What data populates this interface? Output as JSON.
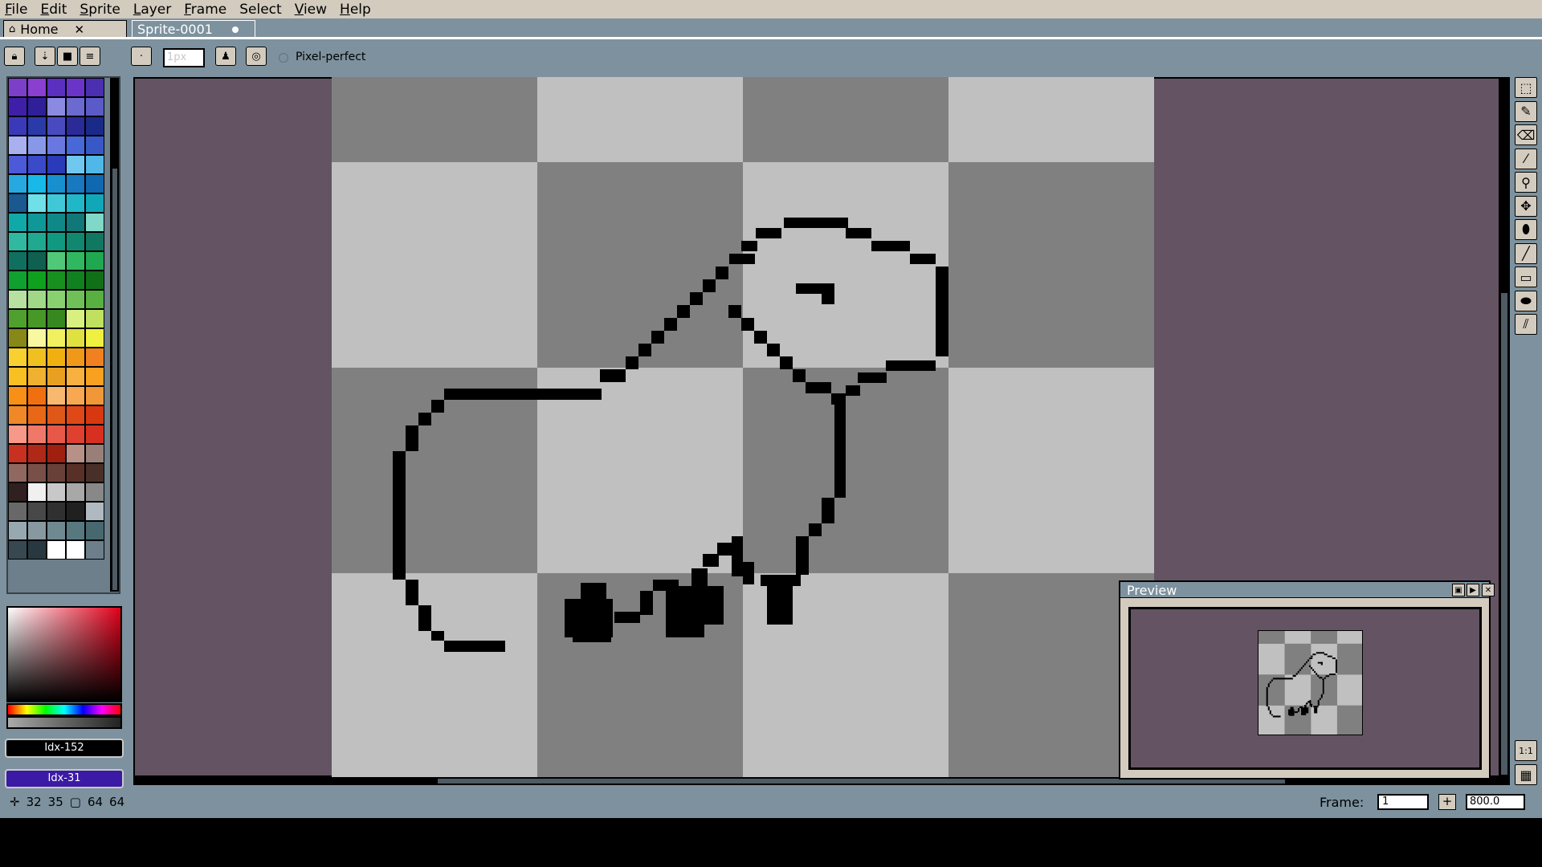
{
  "menu": {
    "items": [
      {
        "label": "File",
        "ul": "F",
        "rest": "ile"
      },
      {
        "label": "Edit",
        "ul": "E",
        "rest": "dit"
      },
      {
        "label": "Sprite",
        "ul": "S",
        "rest": "prite"
      },
      {
        "label": "Layer",
        "ul": "L",
        "rest": "ayer"
      },
      {
        "label": "Frame",
        "ul": "F",
        "rest": "rame"
      },
      {
        "label": "Select",
        "ul": "",
        "rest": "Select"
      },
      {
        "label": "View",
        "ul": "V",
        "rest": "iew"
      },
      {
        "label": "Help",
        "ul": "H",
        "rest": "elp"
      }
    ]
  },
  "tabs": {
    "home_label": "Home",
    "home_close": "✕",
    "sprite_label": "Sprite-0001"
  },
  "toolbar": {
    "brush_size_placeholder": "1px",
    "pixel_perfect_label": "Pixel-perfect"
  },
  "palette": {
    "colors": [
      "#7b3fc8",
      "#8a3fd0",
      "#5b2fc0",
      "#6a34c8",
      "#4a2fb0",
      "#3f1fa8",
      "#2f1f98",
      "#8a8ae0",
      "#6a6ad0",
      "#5a5ac8",
      "#3a3ab8",
      "#2a3aa8",
      "#4a4ac0",
      "#2a2a98",
      "#1a2a88",
      "#a8b0f0",
      "#8898e8",
      "#6878e0",
      "#4868d8",
      "#3858c8",
      "#4a5ad8",
      "#3a4ac8",
      "#2a3ab8",
      "#70c8f0",
      "#50b8e8",
      "#28a8e0",
      "#18b8e8",
      "#1890d0",
      "#1878c0",
      "#0f68b0",
      "#1a5890",
      "#70e0e8",
      "#40c8d8",
      "#20b8c8",
      "#10a8b8",
      "#10a8a8",
      "#109898",
      "#108888",
      "#107878",
      "#80d8c8",
      "#30b8a0",
      "#20a890",
      "#109880",
      "#108870",
      "#107860",
      "#0f7060",
      "#0f6050",
      "#50c878",
      "#30b860",
      "#20a850",
      "#10a030",
      "#10a020",
      "#189020",
      "#108020",
      "#0f7018",
      "#b8e0a0",
      "#a0d888",
      "#88d070",
      "#70c058",
      "#58b040",
      "#50a030",
      "#489828",
      "#388820",
      "#d8f080",
      "#c0e060",
      "#888818",
      "#f8f8a0",
      "#f0f060",
      "#e0e040",
      "#f0f040",
      "#f8d030",
      "#f0c020",
      "#f0b010",
      "#f09818",
      "#f08020",
      "#f8c020",
      "#f0b030",
      "#e8a020",
      "#f8b040",
      "#f8a020",
      "#f89018",
      "#f07010",
      "#f8b870",
      "#f8a850",
      "#f09838",
      "#f08828",
      "#e86818",
      "#e05818",
      "#e04818",
      "#d83810",
      "#f89888",
      "#f07868",
      "#e85848",
      "#e04030",
      "#d83020",
      "#c83020",
      "#b02818",
      "#a02010",
      "#b89088",
      "#988078",
      "#906860",
      "#785048",
      "#684038",
      "#583028",
      "#483028",
      "#302020",
      "#f0f0f0",
      "#c8c8c8",
      "#a8a8a8",
      "#888888",
      "#686868",
      "#484848",
      "#303030",
      "#202020",
      "#b0b8c0",
      "#98a8b0",
      "#8898a0",
      "#708890",
      "#587880",
      "#486870",
      "#384850",
      "#283840",
      "#ffffff",
      "#ffffff",
      "#6d7f8b"
    ]
  },
  "colors": {
    "fg_label": "Idx-152",
    "bg_label": "Idx-31",
    "accent": "#7d929e",
    "canvas_bg": "#645463"
  },
  "tools": {
    "icons": [
      "marquee-icon",
      "pencil-icon",
      "eraser-icon",
      "eyedropper-icon",
      "zoom-icon",
      "move-icon",
      "fill-icon",
      "line-icon",
      "rectangle-icon",
      "ellipse-icon",
      "brush-icon"
    ],
    "zoom_reset_label": "1:1"
  },
  "preview": {
    "title": "Preview"
  },
  "status": {
    "cursor_x": "32",
    "cursor_y": "35",
    "size_w": "64",
    "size_h": "64",
    "frame_label": "Frame:",
    "frame_value": "1",
    "add_frame": "+",
    "zoom_value": "800.0"
  }
}
